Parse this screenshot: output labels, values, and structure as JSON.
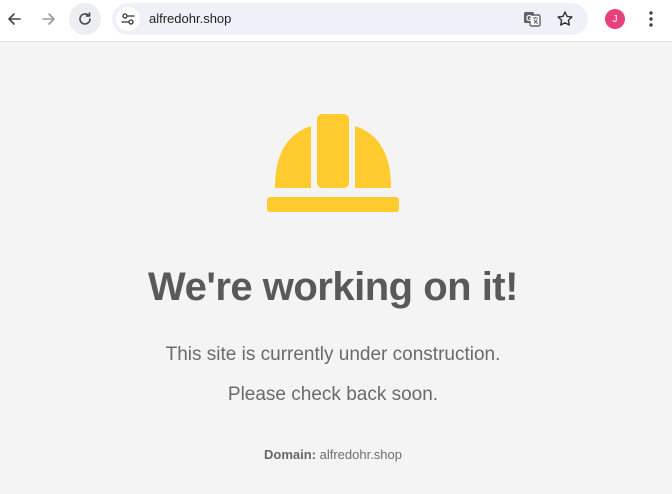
{
  "browser": {
    "url": "alfredohr.shop",
    "profile_initial": "J"
  },
  "content": {
    "headline": "We're working on it!",
    "line1": "This site is currently under construction.",
    "line2": "Please check back soon.",
    "domain_label": "Domain:",
    "domain_value": "alfredohr.shop"
  },
  "colors": {
    "helmet": "#ffcb2f",
    "avatar": "#e8407a"
  }
}
